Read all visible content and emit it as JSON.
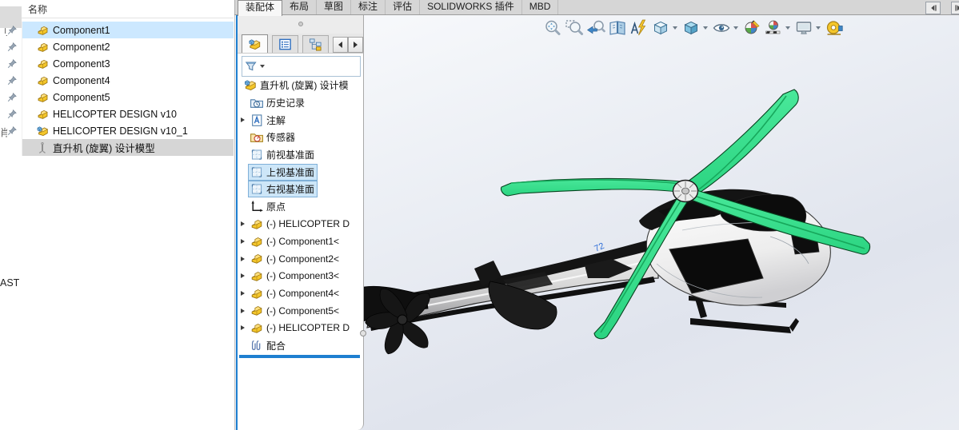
{
  "ribbon": {
    "tabs": [
      {
        "label": "装配体",
        "active": true
      },
      {
        "label": "布局",
        "active": false
      },
      {
        "label": "草图",
        "active": false
      },
      {
        "label": "标注",
        "active": false
      },
      {
        "label": "评估",
        "active": false
      },
      {
        "label": "SOLIDWORKS 插件",
        "active": false
      },
      {
        "label": "MBD",
        "active": false
      }
    ],
    "collapse_buttons": [
      "collapse-panel-left-icon",
      "collapse-panel-right-icon"
    ]
  },
  "left_panel": {
    "header": "名称",
    "edge_fragments": {
      "top": "刂",
      "middle": "肖",
      "bottom": "AST"
    },
    "items": [
      {
        "label": "Component1",
        "icon": "component-part-icon",
        "selected": "blue",
        "pinned": true
      },
      {
        "label": "Component2",
        "icon": "component-part-icon",
        "selected": "none",
        "pinned": true
      },
      {
        "label": "Component3",
        "icon": "component-part-icon",
        "selected": "none",
        "pinned": true
      },
      {
        "label": "Component4",
        "icon": "component-part-icon",
        "selected": "none",
        "pinned": true
      },
      {
        "label": "Component5",
        "icon": "component-part-icon",
        "selected": "none",
        "pinned": true
      },
      {
        "label": "HELICOPTER DESIGN v10",
        "icon": "component-part-icon",
        "selected": "none",
        "pinned": true
      },
      {
        "label": "HELICOPTER DESIGN v10_1",
        "icon": "assembly-doc-icon",
        "selected": "none",
        "pinned": true
      },
      {
        "label": "直升机 (旋翼) 设计模型",
        "icon": "model-config-icon",
        "selected": "gray",
        "pinned": false
      }
    ]
  },
  "feature_panel": {
    "tab_icons": [
      "featuremanager-tree-tab",
      "propertymanager-tab",
      "configurationmanager-tab"
    ],
    "filter_icon": "filter-funnel-icon",
    "tree_items": [
      {
        "label": "直升机 (旋翼) 设计模",
        "icon": "assembly-root-icon",
        "level": 0,
        "expandable": false,
        "selected": false
      },
      {
        "label": "历史记录",
        "icon": "history-folder-icon",
        "level": 1,
        "expandable": false,
        "selected": false
      },
      {
        "label": "注解",
        "icon": "annotations-icon",
        "level": 1,
        "expandable": true,
        "selected": false
      },
      {
        "label": "传感器",
        "icon": "sensors-icon",
        "level": 1,
        "expandable": false,
        "selected": false
      },
      {
        "label": "前视基准面",
        "icon": "plane-icon",
        "level": 1,
        "expandable": false,
        "selected": false
      },
      {
        "label": "上视基准面",
        "icon": "plane-icon",
        "level": 1,
        "expandable": false,
        "selected": true
      },
      {
        "label": "右视基准面",
        "icon": "plane-icon",
        "level": 1,
        "expandable": false,
        "selected": true
      },
      {
        "label": "原点",
        "icon": "origin-icon",
        "level": 1,
        "expandable": false,
        "selected": false
      },
      {
        "label": "(-) HELICOPTER D",
        "icon": "component-part-icon",
        "level": 1,
        "expandable": true,
        "selected": false
      },
      {
        "label": "(-) Component1<",
        "icon": "component-part-icon",
        "level": 1,
        "expandable": true,
        "selected": false
      },
      {
        "label": "(-) Component2<",
        "icon": "component-part-icon",
        "level": 1,
        "expandable": true,
        "selected": false
      },
      {
        "label": "(-) Component3<",
        "icon": "component-part-icon",
        "level": 1,
        "expandable": true,
        "selected": false
      },
      {
        "label": "(-) Component4<",
        "icon": "component-part-icon",
        "level": 1,
        "expandable": true,
        "selected": false
      },
      {
        "label": "(-) Component5<",
        "icon": "component-part-icon",
        "level": 1,
        "expandable": true,
        "selected": false
      },
      {
        "label": "(-) HELICOPTER D",
        "icon": "component-part-icon",
        "level": 1,
        "expandable": true,
        "selected": false
      },
      {
        "label": "配合",
        "icon": "mates-paperclip-icon",
        "level": 1,
        "expandable": false,
        "selected": false
      }
    ]
  },
  "headsup_toolbar": {
    "buttons": [
      {
        "icon": "zoom-to-fit-icon",
        "dropdown": false
      },
      {
        "icon": "zoom-to-area-icon",
        "dropdown": false
      },
      {
        "icon": "previous-view-icon",
        "dropdown": false
      },
      {
        "icon": "section-view-icon",
        "dropdown": false
      },
      {
        "icon": "annotation-views-icon",
        "dropdown": false
      },
      {
        "icon": "view-orientation-icon",
        "dropdown": true
      },
      {
        "icon": "display-style-icon",
        "dropdown": true
      },
      {
        "icon": "hide-show-items-icon",
        "dropdown": true
      },
      {
        "icon": "edit-appearance-icon",
        "dropdown": false
      },
      {
        "icon": "apply-scene-icon",
        "dropdown": true
      },
      {
        "icon": "view-settings-icon",
        "dropdown": true
      },
      {
        "icon": "measure-icon",
        "dropdown": false
      }
    ]
  },
  "viewport": {
    "model_description": "直升机装配体 (绿色四叶旋翼, 黑白机身)",
    "registration_marking": "72",
    "colors": {
      "rotor_green": "#3bdd8c",
      "rotor_green_dark": "#1da663",
      "fuselage_white": "#f7f7f7",
      "canopy_black": "#0d0d0d",
      "accent_blue": "#1e7fd0",
      "selection_blue": "#cce8ff",
      "selection_gray": "#d6d6d6"
    }
  }
}
